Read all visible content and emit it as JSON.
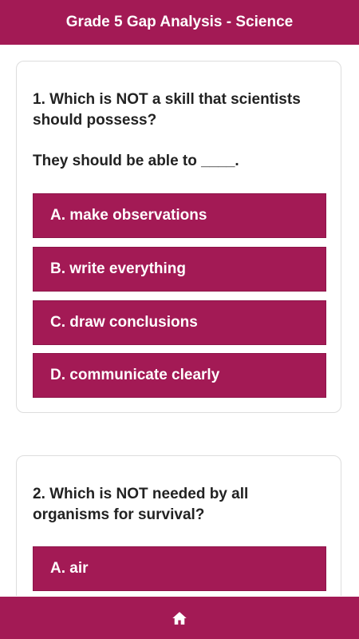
{
  "header": {
    "title": "Grade 5 Gap Analysis - Science"
  },
  "questions": [
    {
      "text": "1. Which is NOT a skill that scientists should possess?",
      "subtext": "They should be able to ____.",
      "options": [
        "A. make observations",
        "B. write everything",
        "C. draw conclusions",
        "D. communicate clearly"
      ]
    },
    {
      "text": "2. Which is NOT needed by all organisms for survival?",
      "options": [
        "A. air"
      ]
    }
  ],
  "footer": {
    "home_icon": "home-icon"
  },
  "colors": {
    "accent": "#a31a55",
    "text": "#222222",
    "card_border": "#dddddd"
  }
}
